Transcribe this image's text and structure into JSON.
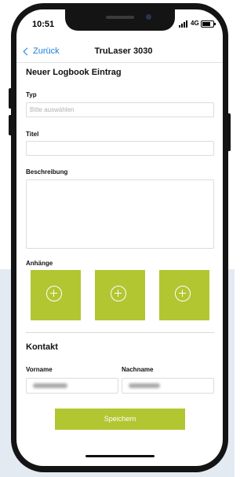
{
  "status_bar": {
    "time": "10:51",
    "network": "4G"
  },
  "nav": {
    "back_label": "Zurück",
    "title": "TruLaser 3030"
  },
  "form": {
    "heading": "Neuer Logbook Eintrag",
    "type_label": "Typ",
    "type_placeholder": "Bitte auswählen",
    "title_label": "Titel",
    "title_value": "",
    "description_label": "Beschreibung",
    "description_value": "",
    "attachments_label": "Anhänge"
  },
  "attachments": [
    {
      "icon": "plus-circle-icon"
    },
    {
      "icon": "plus-circle-icon"
    },
    {
      "icon": "plus-circle-icon"
    }
  ],
  "contact": {
    "heading": "Kontakt",
    "first_name_label": "Vorname",
    "last_name_label": "Nachname"
  },
  "save_label": "Speichern",
  "colors": {
    "accent": "#b2c632",
    "link": "#1a7fd6"
  }
}
